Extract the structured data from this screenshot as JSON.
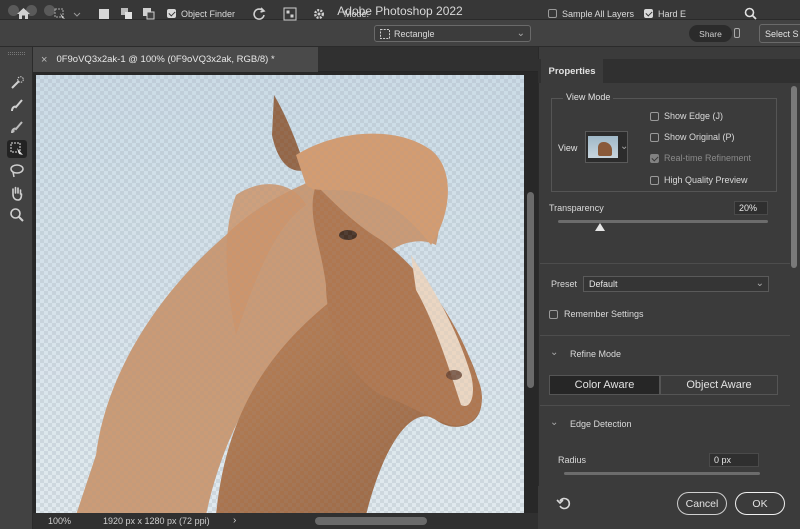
{
  "window": {
    "title": "Adobe Photoshop 2022"
  },
  "options_bar": {
    "object_finder_label": "Object Finder",
    "mode_label": "Mode:",
    "mode_value": "Rectangle",
    "sample_all_layers_label": "Sample All Layers",
    "hard_edge_label": "Hard E",
    "share_label": "Share",
    "select_subject_label": "Select S"
  },
  "document": {
    "tab_title": "0F9oVQ3x2ak-1 @ 100% (0F9oVQ3x2ak, RGB/8) *",
    "close_glyph": "×"
  },
  "status_bar": {
    "zoom": "100%",
    "dimensions": "1920 px x 1280 px (72 ppi)",
    "arrow": "›"
  },
  "properties": {
    "tab_label": "Properties",
    "view_mode_label": "View Mode",
    "view_label": "View",
    "show_edge_label": "Show Edge (J)",
    "show_original_label": "Show Original (P)",
    "realtime_label": "Real-time Refinement",
    "hq_preview_label": "High Quality Preview",
    "transparency_label": "Transparency",
    "transparency_value": "20%",
    "transparency_level": 0.2,
    "preset_label": "Preset",
    "preset_value": "Default",
    "remember_label": "Remember Settings",
    "refine_mode_label": "Refine Mode",
    "color_aware_label": "Color Aware",
    "object_aware_label": "Object Aware",
    "edge_detection_label": "Edge Detection",
    "radius_label": "Radius",
    "radius_value": "0 px",
    "cancel_label": "Cancel",
    "ok_label": "OK"
  },
  "colors": {
    "accent": "#2a2a2a",
    "sky": "#c9dbe6",
    "horse": "#a5683f",
    "mane": "#c98c5e"
  }
}
